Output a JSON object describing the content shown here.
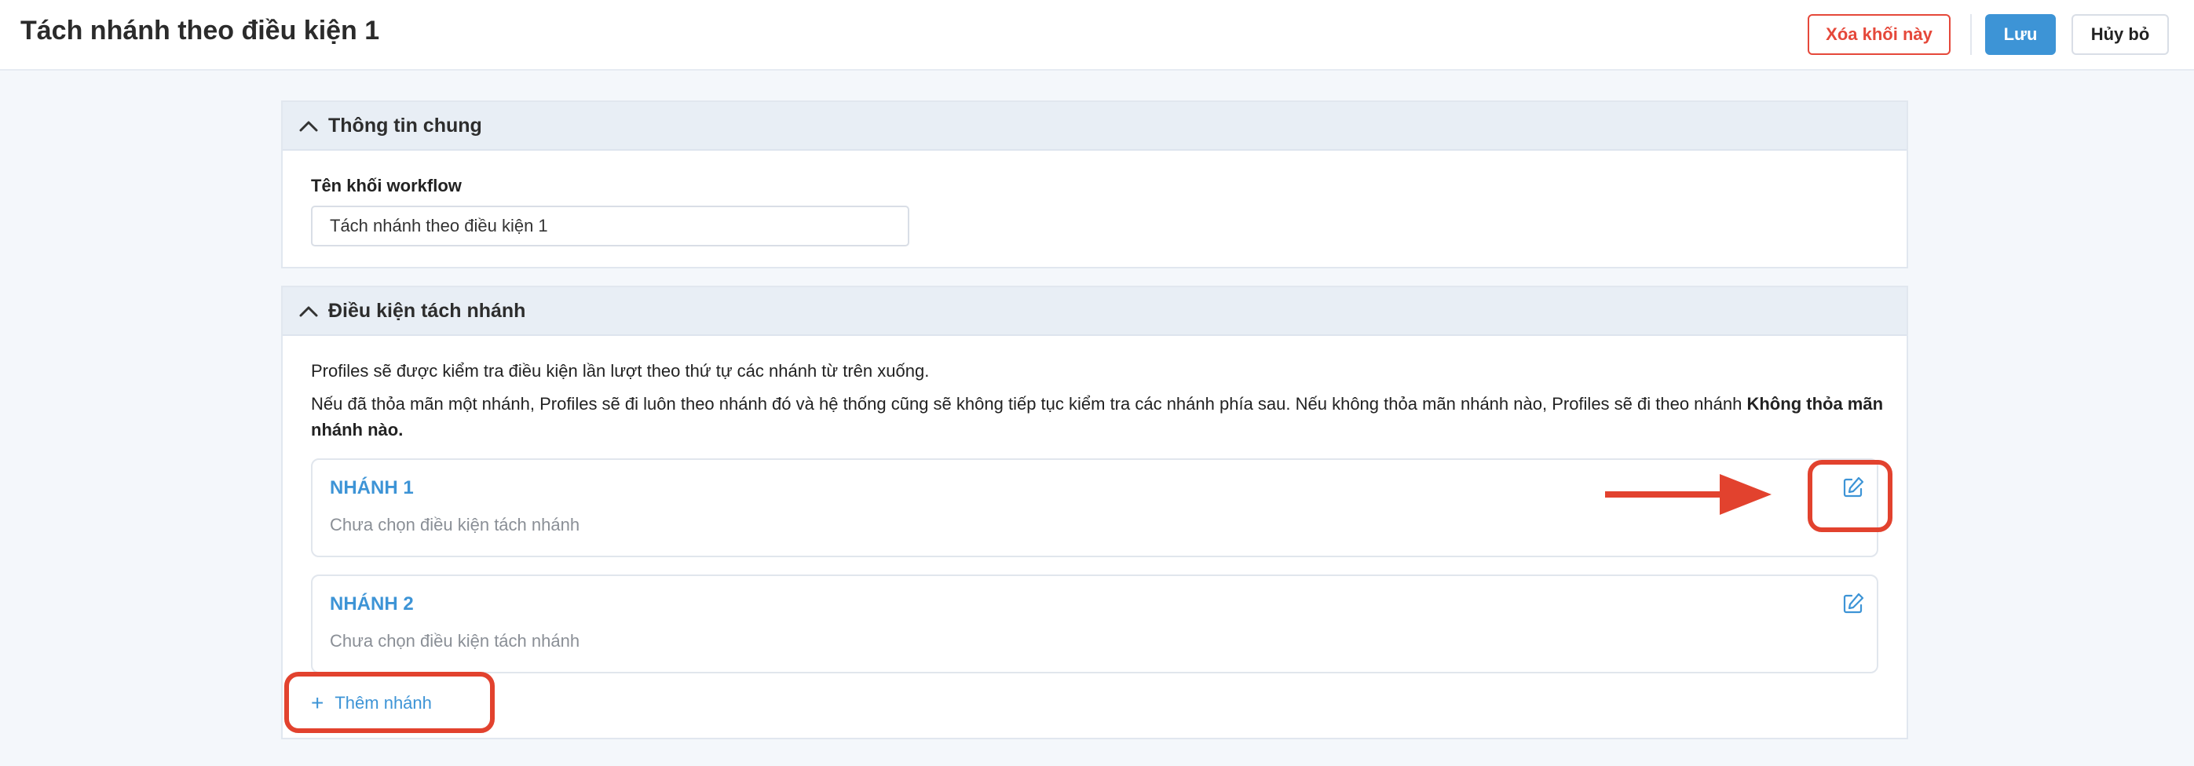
{
  "header": {
    "title": "Tách nhánh theo điều kiện 1",
    "delete_label": "Xóa khối này",
    "save_label": "Lưu",
    "cancel_label": "Hủy bỏ"
  },
  "general_info": {
    "section_title": "Thông tin chung",
    "name_label": "Tên khối workflow",
    "name_value": "Tách nhánh theo điều kiện 1"
  },
  "split_conditions": {
    "section_title": "Điều kiện tách nhánh",
    "description_line1": "Profiles sẽ được kiểm tra điều kiện lần lượt theo thứ tự các nhánh từ trên xuống.",
    "description_line2_prefix": "Nếu đã thỏa mãn một nhánh, Profiles sẽ đi luôn theo nhánh đó và hệ thống cũng sẽ không tiếp tục kiểm tra các nhánh phía sau. Nếu không thỏa mãn nhánh nào, Profiles sẽ đi theo nhánh ",
    "description_line2_bold": "Không thỏa mãn nhánh nào.",
    "branches": [
      {
        "name": "NHÁNH 1",
        "status": "Chưa chọn điều kiện tách nhánh"
      },
      {
        "name": "NHÁNH 2",
        "status": "Chưa chọn điều kiện tách nhánh"
      }
    ],
    "add_branch_label": "Thêm nhánh"
  },
  "icons": {
    "collapse": "chevron-up-icon",
    "edit": "edit-icon",
    "add": "plus-icon"
  },
  "colors": {
    "accent": "#3d94d6",
    "danger": "#e5483a",
    "annotation": "#e2422e"
  }
}
